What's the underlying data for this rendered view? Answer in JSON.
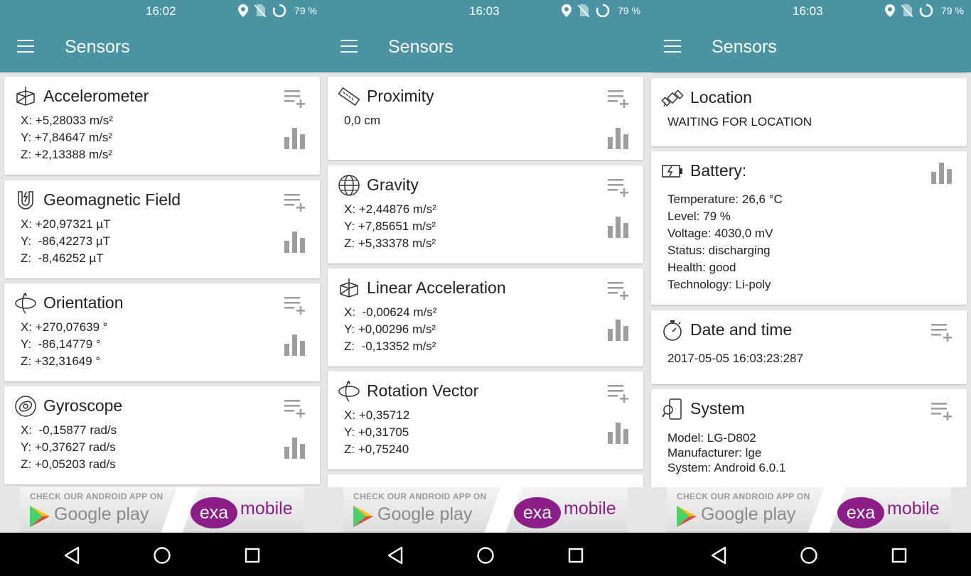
{
  "panels": [
    {
      "status": {
        "time": "16:02",
        "battery": "79 %"
      },
      "title": "Sensors",
      "cards": [
        {
          "title": "Accelerometer",
          "rows": [
            [
              "X:",
              "+5,28033 m/s²"
            ],
            [
              "Y:",
              "+7,84647 m/s²"
            ],
            [
              "Z:",
              "+2,13388 m/s²"
            ]
          ]
        },
        {
          "title": "Geomagnetic Field",
          "rows": [
            [
              "X:",
              "+20,97321 µT"
            ],
            [
              "Y:",
              " -86,42273 µT"
            ],
            [
              "Z:",
              " -8,46252 µT"
            ]
          ]
        },
        {
          "title": "Orientation",
          "rows": [
            [
              "X:",
              "+270,07639 °"
            ],
            [
              "Y:",
              " -86,14779 °"
            ],
            [
              "Z:",
              "+32,31649 °"
            ]
          ]
        },
        {
          "title": "Gyroscope",
          "rows": [
            [
              "X:",
              " -0,15877 rad/s"
            ],
            [
              "Y:",
              "+0,37627 rad/s"
            ],
            [
              "Z:",
              "+0,05203 rad/s"
            ]
          ]
        }
      ]
    },
    {
      "status": {
        "time": "16:03",
        "battery": "79 %"
      },
      "title": "Sensors",
      "cards": [
        {
          "title": "Proximity",
          "rows": [
            [
              "",
              "0,0 cm"
            ]
          ]
        },
        {
          "title": "Gravity",
          "rows": [
            [
              "X:",
              "+2,44876 m/s²"
            ],
            [
              "Y:",
              "+7,85651 m/s²"
            ],
            [
              "Z:",
              "+5,33378 m/s²"
            ]
          ]
        },
        {
          "title": "Linear Acceleration",
          "rows": [
            [
              "X:",
              " -0,00624 m/s²"
            ],
            [
              "Y:",
              "+0,00296 m/s²"
            ],
            [
              "Z:",
              " -0,13352 m/s²"
            ]
          ]
        },
        {
          "title": "Rotation Vector",
          "rows": [
            [
              "X:",
              "+0,35712"
            ],
            [
              "Y:",
              "+0,31705"
            ],
            [
              "Z:",
              "+0,75240"
            ]
          ]
        }
      ]
    },
    {
      "status": {
        "time": "16:03",
        "battery": "79 %"
      },
      "title": "Sensors",
      "cards": [
        {
          "title": "Location",
          "rows": [
            [
              "",
              "WAITING FOR LOCATION"
            ]
          ]
        },
        {
          "title": "Battery:",
          "rows": [
            [
              "Temperature:",
              "26,6 °C"
            ],
            [
              "Level:",
              "79 %"
            ],
            [
              "Voltage:",
              "4030,0 mV"
            ],
            [
              "Status:",
              "discharging"
            ],
            [
              "Health:",
              "good"
            ],
            [
              "Technology:",
              "Li-poly"
            ]
          ]
        },
        {
          "title": "Date and time",
          "rows": [
            [
              "",
              "2017-05-05 16:03:23:287"
            ]
          ]
        },
        {
          "title": "System",
          "rows": [
            [
              "Model:",
              "LG-D802"
            ],
            [
              "Manufacturer:",
              "lge"
            ],
            [
              "System:",
              "Android 6.0.1"
            ]
          ]
        }
      ]
    }
  ],
  "ad": {
    "check": "CHECK OUR ANDROID APP ON",
    "google_play": "Google play",
    "exa": "exa",
    "mobile": "mobile"
  },
  "colors": {
    "appbar": "#4a93a3",
    "icon_gray": "#9e9e9e",
    "exa_purple": "#8b1e88"
  },
  "icons": [
    "menu-icon",
    "location-icon",
    "no-sim-icon",
    "battery-ring-icon",
    "add-log-icon",
    "bar-chart-icon",
    "back-icon",
    "home-icon",
    "recent-apps-icon"
  ]
}
